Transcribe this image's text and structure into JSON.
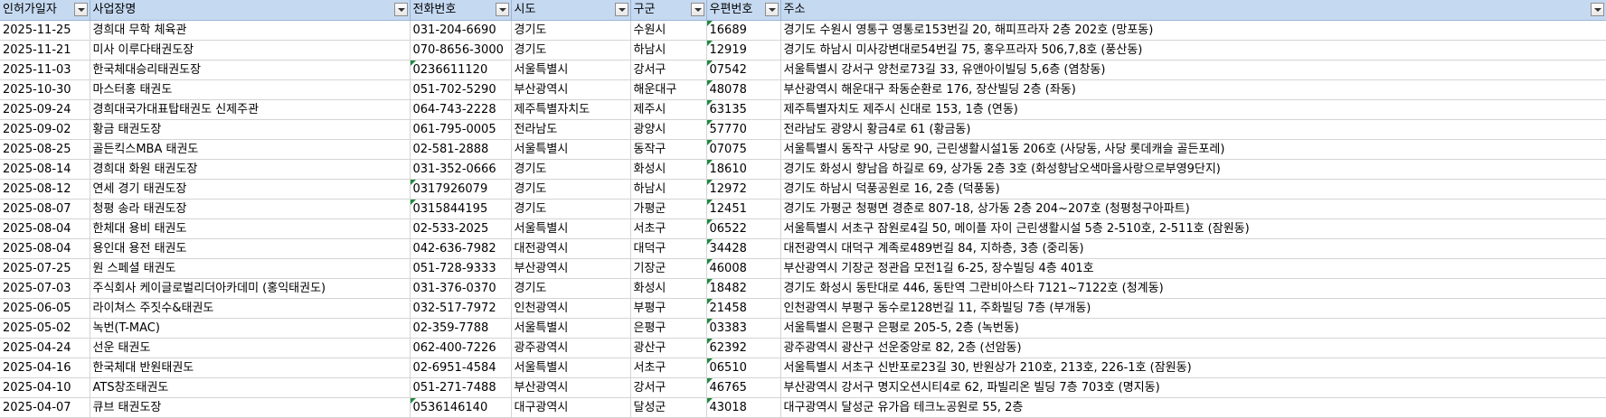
{
  "headers": [
    "인허가일자",
    "사업장명",
    "전화번호",
    "시도",
    "구군",
    "우편번호",
    "주소"
  ],
  "filter_icon": "filter-dropdown-icon",
  "colors": {
    "header_bg": "#c5d9f1",
    "grid": "#d4d4d4",
    "error_marker": "#1e8a3e"
  },
  "rows": [
    {
      "date": "2025-11-25",
      "name": "경희대 무학 체육관",
      "phone": "031-204-6690",
      "phone_text_number": false,
      "sido": "경기도",
      "gugun": "수원시",
      "zip": "16689",
      "addr": "경기도 수원시 영통구 영통로153번길 20, 해피프라자 2층 202호 (망포동)"
    },
    {
      "date": "2025-11-21",
      "name": "미사 이루다태권도장",
      "phone": "070-8656-3000",
      "phone_text_number": false,
      "sido": "경기도",
      "gugun": "하남시",
      "zip": "12919",
      "addr": "경기도 하남시 미사강변대로54번길 75, 홍우프라자 506,7,8호 (풍산동)"
    },
    {
      "date": "2025-11-03",
      "name": "한국체대승리태권도장",
      "phone": "0236611120",
      "phone_text_number": true,
      "sido": "서울특별시",
      "gugun": "강서구",
      "zip": "07542",
      "addr": "서울특별시 강서구 양천로73길 33, 유앤아이빌딩 5,6층 (염창동)"
    },
    {
      "date": "2025-10-30",
      "name": "마스터홍 태권도",
      "phone": "051-702-5290",
      "phone_text_number": false,
      "sido": "부산광역시",
      "gugun": "해운대구",
      "zip": "48078",
      "addr": "부산광역시 해운대구 좌동순환로 176, 장산빌딩 2층 (좌동)"
    },
    {
      "date": "2025-09-24",
      "name": "경희대국가대표탑태권도 신제주관",
      "phone": "064-743-2228",
      "phone_text_number": false,
      "sido": "제주특별자치도",
      "gugun": "제주시",
      "zip": "63135",
      "addr": "제주특별자치도 제주시 신대로 153, 1층 (연동)"
    },
    {
      "date": "2025-09-02",
      "name": "황금 태권도장",
      "phone": "061-795-0005",
      "phone_text_number": false,
      "sido": "전라남도",
      "gugun": "광양시",
      "zip": "57770",
      "addr": "전라남도 광양시 황금4로 61 (황금동)"
    },
    {
      "date": "2025-08-25",
      "name": "골든킥스MBA 태권도",
      "phone": "02-581-2888",
      "phone_text_number": false,
      "sido": "서울특별시",
      "gugun": "동작구",
      "zip": "07075",
      "addr": "서울특별시 동작구 사당로 90, 근린생활시설1동 206호 (사당동, 사당 롯데캐슬 골든포레)"
    },
    {
      "date": "2025-08-14",
      "name": "경희대 화원 태권도장",
      "phone": "031-352-0666",
      "phone_text_number": false,
      "sido": "경기도",
      "gugun": "화성시",
      "zip": "18610",
      "addr": "경기도 화성시 향남읍 하길로 69, 상가동 2층 3호 (화성향남오색마을사랑으로부영9단지)"
    },
    {
      "date": "2025-08-12",
      "name": "연세 경기 태권도장",
      "phone": "0317926079",
      "phone_text_number": true,
      "sido": "경기도",
      "gugun": "하남시",
      "zip": "12972",
      "addr": "경기도 하남시 덕풍공원로 16, 2층 (덕풍동)"
    },
    {
      "date": "2025-08-07",
      "name": "청평 송라 태권도장",
      "phone": "0315844195",
      "phone_text_number": true,
      "sido": "경기도",
      "gugun": "가평군",
      "zip": "12451",
      "addr": "경기도 가평군 청평면 경춘로 807-18, 상가동 2층 204~207호 (청평청구아파트)"
    },
    {
      "date": "2025-08-04",
      "name": "한체대 용비 태권도",
      "phone": "02-533-2025",
      "phone_text_number": false,
      "sido": "서울특별시",
      "gugun": "서초구",
      "zip": "06522",
      "addr": "서울특별시 서초구 잠원로4길 50, 메이플 자이 근린생활시설 5층 2-510호, 2-511호 (잠원동)"
    },
    {
      "date": "2025-08-04",
      "name": "용인대 용전 태권도",
      "phone": "042-636-7982",
      "phone_text_number": false,
      "sido": "대전광역시",
      "gugun": "대덕구",
      "zip": "34428",
      "addr": "대전광역시 대덕구 계족로489번길 84, 지하층, 3층 (중리동)"
    },
    {
      "date": "2025-07-25",
      "name": "원 스페셜 태권도",
      "phone": "051-728-9333",
      "phone_text_number": false,
      "sido": "부산광역시",
      "gugun": "기장군",
      "zip": "46008",
      "addr": "부산광역시 기장군 정관읍 모전1길 6-25, 장수빌딩 4층 401호"
    },
    {
      "date": "2025-07-03",
      "name": "주식회사 케이글로벌리더아카데미 (홍익태권도)",
      "phone": "031-376-0370",
      "phone_text_number": false,
      "sido": "경기도",
      "gugun": "화성시",
      "zip": "18482",
      "addr": "경기도 화성시 동탄대로 446, 동탄역 그란비아스타 7121~7122호 (청계동)"
    },
    {
      "date": "2025-06-05",
      "name": "라이쳐스 주짓수&태권도",
      "phone": "032-517-7972",
      "phone_text_number": false,
      "sido": "인천광역시",
      "gugun": "부평구",
      "zip": "21458",
      "addr": "인천광역시 부평구 동수로128번길 11, 주화빌딩 7층 (부개동)"
    },
    {
      "date": "2025-05-02",
      "name": "녹번(T-MAC)",
      "phone": "02-359-7788",
      "phone_text_number": false,
      "sido": "서울특별시",
      "gugun": "은평구",
      "zip": "03383",
      "addr": "서울특별시 은평구 은평로 205-5, 2층 (녹번동)"
    },
    {
      "date": "2025-04-24",
      "name": "선운 태권도",
      "phone": "062-400-7226",
      "phone_text_number": false,
      "sido": "광주광역시",
      "gugun": "광산구",
      "zip": "62392",
      "addr": "광주광역시 광산구 선운중앙로 82, 2층 (선암동)"
    },
    {
      "date": "2025-04-16",
      "name": "한국체대 반원태권도",
      "phone": "02-6951-4584",
      "phone_text_number": false,
      "sido": "서울특별시",
      "gugun": "서초구",
      "zip": "06510",
      "addr": "서울특별시 서초구 신반포로23길 30, 반원상가 210호, 213호, 226-1호 (잠원동)"
    },
    {
      "date": "2025-04-10",
      "name": "ATS창조태권도",
      "phone": "051-271-7488",
      "phone_text_number": false,
      "sido": "부산광역시",
      "gugun": "강서구",
      "zip": "46765",
      "addr": "부산광역시 강서구 명지오션시티4로 62, 파빌리온 빌딩 7층 703호 (명지동)"
    },
    {
      "date": "2025-04-07",
      "name": "큐브 태권도장",
      "phone": "0536146140",
      "phone_text_number": true,
      "sido": "대구광역시",
      "gugun": "달성군",
      "zip": "43018",
      "addr": "대구광역시 달성군 유가읍 테크노공원로 55, 2층"
    }
  ]
}
